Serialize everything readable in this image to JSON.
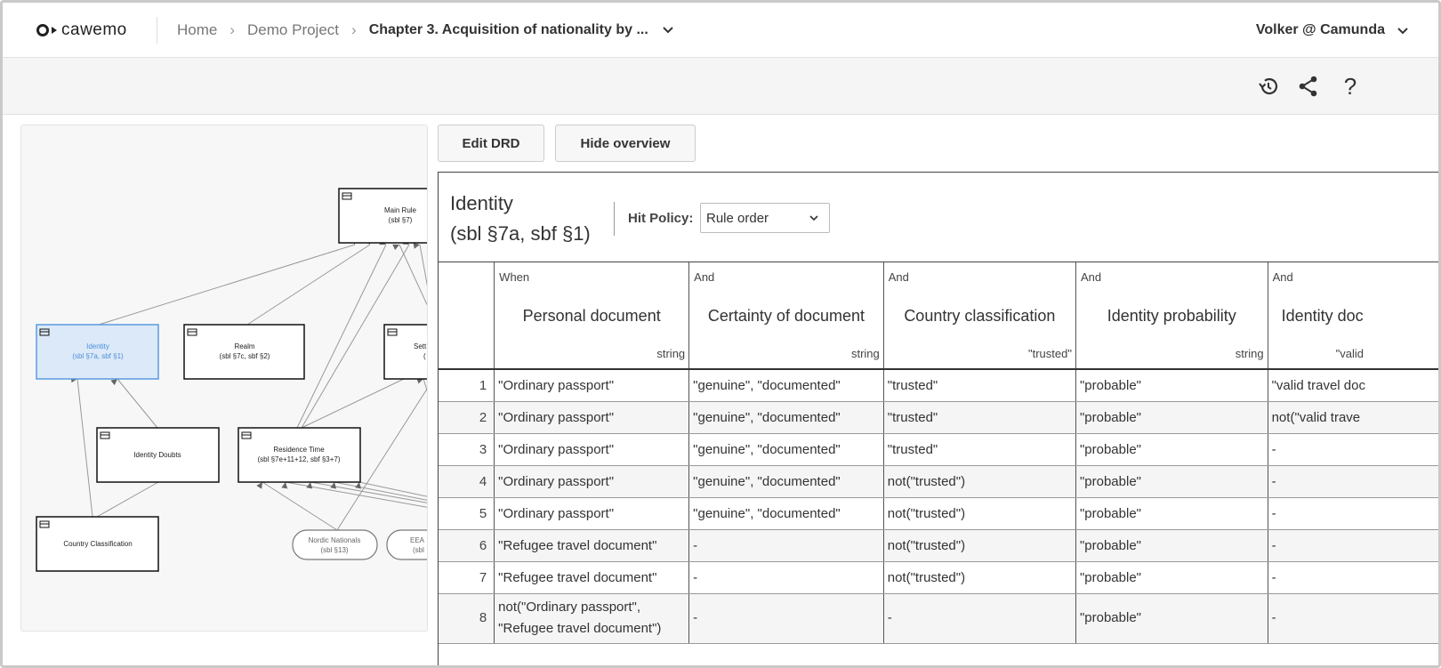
{
  "app": {
    "logo_text": "cawemo"
  },
  "breadcrumb": {
    "home": "Home",
    "project": "Demo Project",
    "current": "Chapter 3. Acquisition of nationality by ..."
  },
  "user": {
    "name": "Volker @ Camunda"
  },
  "toolbar": {
    "icons": [
      "history-icon",
      "share-icon",
      "help-icon"
    ],
    "help_glyph": "?"
  },
  "actions": {
    "edit_drd": "Edit DRD",
    "hide_overview": "Hide overview"
  },
  "drd": {
    "nodes": {
      "main_rule": [
        "Main Rule",
        "(sbl §7)"
      ],
      "identity": [
        "Identity",
        "(sbl §7a, sbf §1)"
      ],
      "realm": [
        "Realm",
        "(sbl §7c, sbf §2)"
      ],
      "settlement": [
        "Sett",
        "("
      ],
      "identity_doubts": [
        "Identity Doubts"
      ],
      "residence_time": [
        "Residence Time",
        "(sbl §7e+11+12, sbf §3+7)"
      ],
      "country_classification": [
        "Country Classification"
      ],
      "nordic_nationals": [
        "Nordic Nationals",
        "(sbl §13)"
      ],
      "eea": [
        "EEA",
        "(sbl"
      ]
    }
  },
  "decision": {
    "name_line1": "Identity",
    "name_line2": "(sbl §7a, sbf §1)",
    "hit_policy_label": "Hit Policy:",
    "hit_policy_value": "Rule order",
    "columns": [
      {
        "clause": "When",
        "label": "Personal document",
        "type": "string"
      },
      {
        "clause": "And",
        "label": "Certainty of document",
        "type": "string"
      },
      {
        "clause": "And",
        "label": "Country classification",
        "type": "\"trusted\""
      },
      {
        "clause": "And",
        "label": "Identity probability",
        "type": "string"
      },
      {
        "clause": "And",
        "label": "Identity doc",
        "type": "\"valid"
      }
    ],
    "rules": [
      {
        "n": "1",
        "cells": [
          "\"Ordinary passport\"",
          "\"genuine\", \"documented\"",
          "\"trusted\"",
          "\"probable\"",
          "\"valid travel doc"
        ]
      },
      {
        "n": "2",
        "cells": [
          "\"Ordinary passport\"",
          "\"genuine\", \"documented\"",
          "\"trusted\"",
          "\"probable\"",
          "not(\"valid trave"
        ]
      },
      {
        "n": "3",
        "cells": [
          "\"Ordinary passport\"",
          "\"genuine\", \"documented\"",
          "\"trusted\"",
          "\"probable\"",
          "-"
        ]
      },
      {
        "n": "4",
        "cells": [
          "\"Ordinary passport\"",
          "\"genuine\", \"documented\"",
          "not(\"trusted\")",
          "\"probable\"",
          "-"
        ]
      },
      {
        "n": "5",
        "cells": [
          "\"Ordinary passport\"",
          "\"genuine\", \"documented\"",
          "not(\"trusted\")",
          "\"probable\"",
          "-"
        ]
      },
      {
        "n": "6",
        "cells": [
          "\"Refugee travel document\"",
          "-",
          "not(\"trusted\")",
          "\"probable\"",
          "-"
        ]
      },
      {
        "n": "7",
        "cells": [
          "\"Refugee travel document\"",
          "-",
          "not(\"trusted\")",
          "\"probable\"",
          "-"
        ]
      },
      {
        "n": "8",
        "cells": [
          "not(\"Ordinary passport\", \"Refugee travel document\")",
          "-",
          "-",
          "\"probable\"",
          "-"
        ]
      }
    ]
  }
}
